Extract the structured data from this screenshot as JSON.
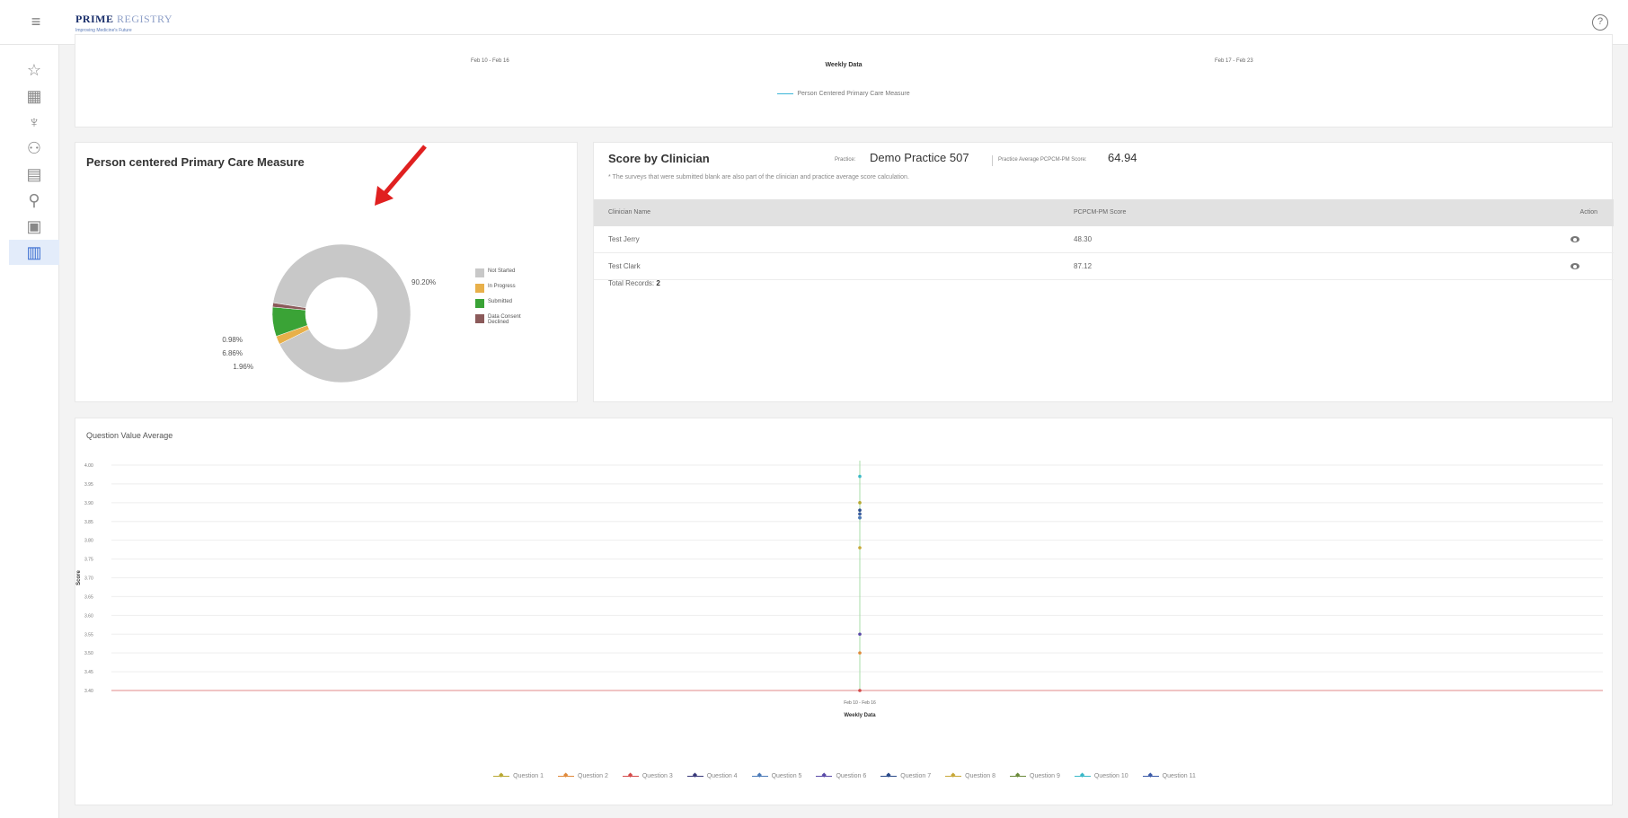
{
  "header": {
    "logo_main": "PRIME",
    "logo_secondary": "REGISTRY",
    "logo_tagline": "Improving Medicine's Future"
  },
  "sidebar": {
    "items": [
      {
        "name": "star-icon",
        "glyph": "☆"
      },
      {
        "name": "building-icon",
        "glyph": "▦"
      },
      {
        "name": "hand-icon",
        "glyph": "♆"
      },
      {
        "name": "users-icon",
        "glyph": "⚇"
      },
      {
        "name": "id-card-icon",
        "glyph": "▤"
      },
      {
        "name": "person-desk-icon",
        "glyph": "⚲"
      },
      {
        "name": "clipboard-icon",
        "glyph": "▣"
      },
      {
        "name": "report-icon",
        "glyph": "▥",
        "active": true
      }
    ]
  },
  "weekly_card": {
    "x_labels": [
      "Feb 10 - Feb 16",
      "Feb 17 - Feb 23"
    ],
    "axis_title": "Weekly Data",
    "legend": "Person Centered Primary Care Measure"
  },
  "pie_card": {
    "title": "Person centered Primary Care Measure",
    "chart_data": {
      "type": "pie",
      "slices": [
        {
          "label": "Not Started",
          "value": 90.2,
          "color": "#c8c8c8"
        },
        {
          "label": "In Progress",
          "value": 1.96,
          "color": "#e8b04a"
        },
        {
          "label": "Submitted",
          "value": 6.86,
          "color": "#3aa336"
        },
        {
          "label": "Data Consent Declined",
          "value": 0.98,
          "color": "#8b5a5a"
        }
      ],
      "data_labels": [
        "90.20%",
        "0.98%",
        "6.86%",
        "1.96%"
      ]
    },
    "legend": [
      "Not Started",
      "In Progress",
      "Submitted",
      "Data Consent Declined"
    ]
  },
  "clinician_card": {
    "title": "Score by Clinician",
    "practice_label": "Practice:",
    "practice_value": "Demo Practice 507",
    "avg_label": "Practice Average PCPCM-PM Score:",
    "avg_value": "64.94",
    "note": "* The surveys that were submitted blank are also part of the clinician and practice average score calculation.",
    "columns": [
      "Clinician Name",
      "PCPCM-PM Score",
      "Action"
    ],
    "rows": [
      {
        "name": "Test Jerry",
        "score": "48.30"
      },
      {
        "name": "Test Clark",
        "score": "87.12"
      }
    ],
    "total_label": "Total Records:",
    "total_value": "2"
  },
  "question_card": {
    "title": "Question Value Average",
    "chart_data": {
      "type": "line",
      "x": [
        "Feb 10 - Feb 16"
      ],
      "xlabel": "Weekly Data",
      "ylabel": "Score",
      "ylim": [
        3.4,
        4.0
      ],
      "yticks": [
        "4.00",
        "3.95",
        "3.90",
        "3.85",
        "3.80",
        "3.75",
        "3.70",
        "3.65",
        "3.60",
        "3.55",
        "3.50",
        "3.45",
        "3.40"
      ],
      "series": [
        {
          "name": "Question 1",
          "values": [
            3.9
          ],
          "color": "#b8a832"
        },
        {
          "name": "Question 2",
          "values": [
            3.5
          ],
          "color": "#e08a3c"
        },
        {
          "name": "Question 3",
          "values": [
            3.4
          ],
          "color": "#d44a4a"
        },
        {
          "name": "Question 4",
          "values": [
            3.86
          ],
          "color": "#3a3a7a"
        },
        {
          "name": "Question 5",
          "values": [
            3.86
          ],
          "color": "#4a7ab8"
        },
        {
          "name": "Question 6",
          "values": [
            3.55
          ],
          "color": "#5a4aa8"
        },
        {
          "name": "Question 7",
          "values": [
            3.88
          ],
          "color": "#2a4a8a"
        },
        {
          "name": "Question 8",
          "values": [
            3.78
          ],
          "color": "#c8a838"
        },
        {
          "name": "Question 9",
          "values": [
            3.87
          ],
          "color": "#6a8a3a"
        },
        {
          "name": "Question 10",
          "values": [
            3.97
          ],
          "color": "#3ab8c8"
        },
        {
          "name": "Question 11",
          "values": [
            3.87
          ],
          "color": "#3a5aa8"
        }
      ]
    }
  }
}
